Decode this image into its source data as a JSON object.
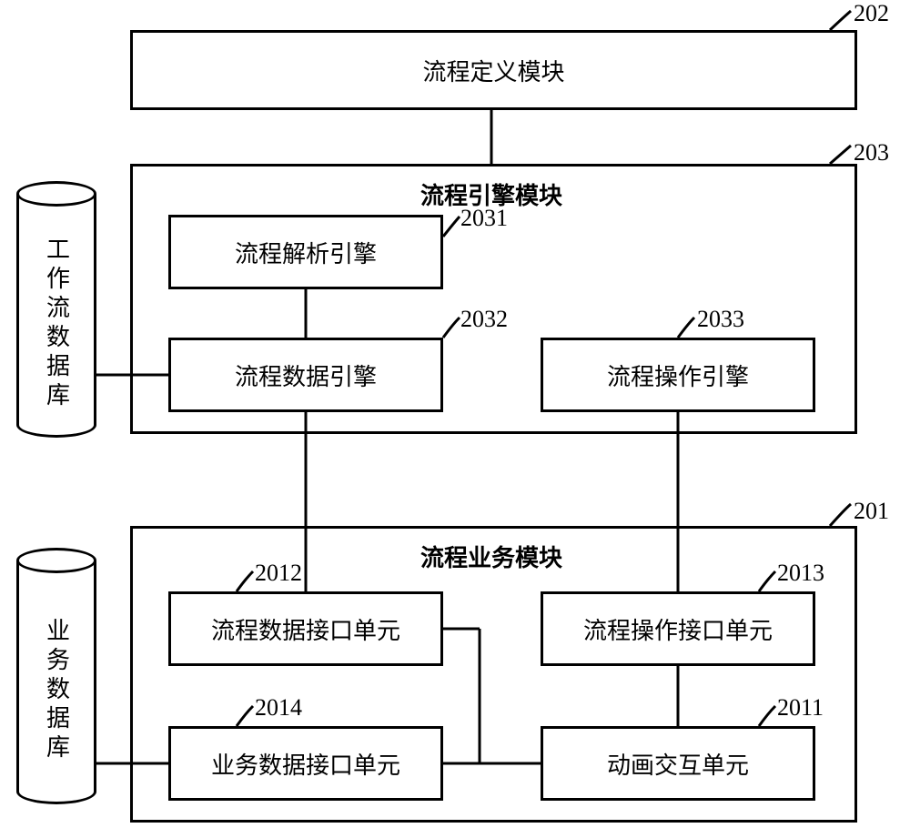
{
  "blocks": {
    "b202": {
      "label": "流程定义模块",
      "ref": "202"
    },
    "b203": {
      "label": "流程引擎模块",
      "ref": "203"
    },
    "b2031": {
      "label": "流程解析引擎",
      "ref": "2031"
    },
    "b2032": {
      "label": "流程数据引擎",
      "ref": "2032"
    },
    "b2033": {
      "label": "流程操作引擎",
      "ref": "2033"
    },
    "b201": {
      "label": "流程业务模块",
      "ref": "201"
    },
    "b2012": {
      "label": "流程数据接口单元",
      "ref": "2012"
    },
    "b2013": {
      "label": "流程操作接口单元",
      "ref": "2013"
    },
    "b2014": {
      "label": "业务数据接口单元",
      "ref": "2014"
    },
    "b2011": {
      "label": "动画交互单元",
      "ref": "2011"
    }
  },
  "cylinders": {
    "workflow_db": "工作流数据库",
    "business_db": "业务数据库"
  }
}
